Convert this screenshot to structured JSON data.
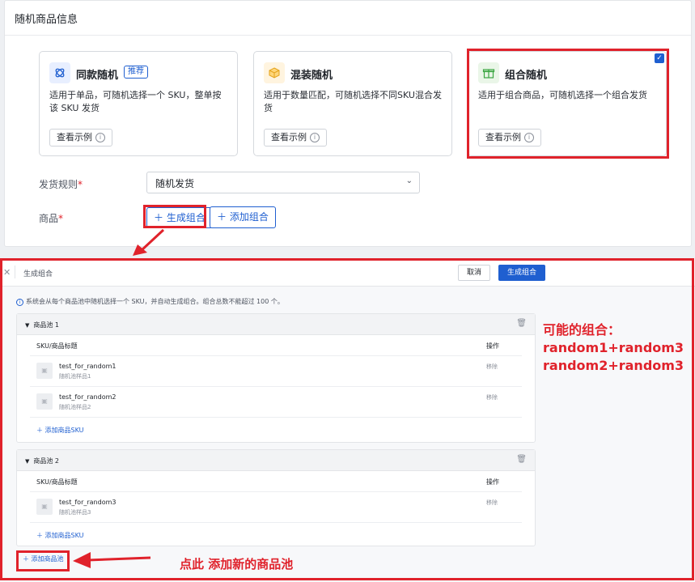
{
  "top": {
    "title": "随机商品信息",
    "cards": [
      {
        "title": "同款随机",
        "tag": "推荐",
        "desc": "适用于单品，可随机选择一个 SKU，整单按该 SKU 发货",
        "example": "查看示例"
      },
      {
        "title": "混装随机",
        "desc": "适用于数量匹配，可随机选择不同SKU混合发货",
        "example": "查看示例"
      },
      {
        "title": "组合随机",
        "desc": "适用于组合商品，可随机选择一个组合发货",
        "example": "查看示例"
      }
    ],
    "ship_rule_label": "发货规则",
    "ship_rule_value": "随机发货",
    "goods_label": "商品",
    "generate_btn": "生成组合",
    "add_btn": "添加组合"
  },
  "modal": {
    "title": "生成组合",
    "cancel": "取消",
    "confirm": "生成组合",
    "info": "系统会从每个商品池中随机选择一个 SKU，并自动生成组合。组合总数不能超过 100 个。",
    "col_sku": "SKU/商品标题",
    "col_op": "操作",
    "pools": [
      {
        "name": "商品池 1",
        "items": [
          {
            "sku": "test_for_random1",
            "sub": "随机池样品1",
            "op": "移除"
          },
          {
            "sku": "test_for_random2",
            "sub": "随机池样品2",
            "op": "移除"
          }
        ],
        "add": "添加商品SKU"
      },
      {
        "name": "商品池 2",
        "items": [
          {
            "sku": "test_for_random3",
            "sub": "随机池样品3",
            "op": "移除"
          }
        ],
        "add": "添加商品SKU"
      }
    ],
    "add_pool": "添加商品池"
  },
  "annotations": {
    "note_lines": [
      "可能的组合：",
      "random1+random3",
      "random2+random3"
    ],
    "callout": "点此 添加新的商品池"
  },
  "colors": {
    "accent": "#1f5fd0",
    "annotation_red": "#e0222b"
  }
}
